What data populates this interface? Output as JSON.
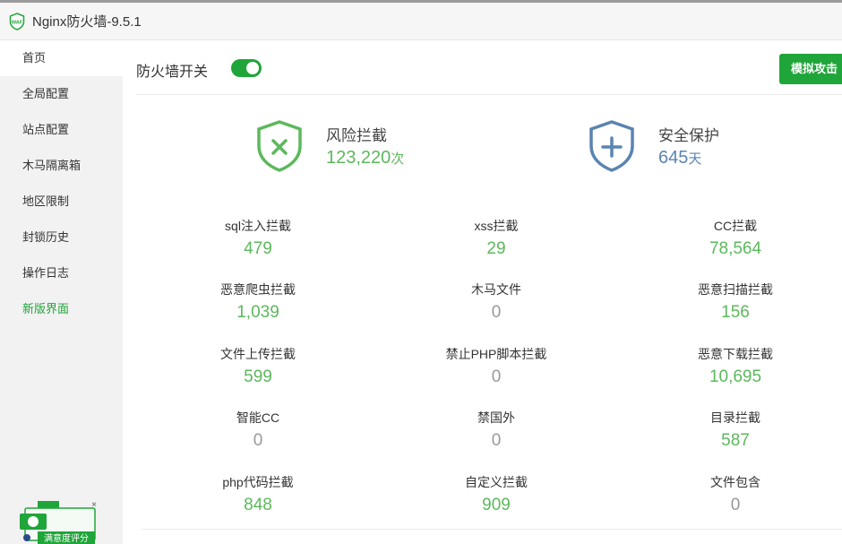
{
  "app": {
    "title": "Nginx防火墙-9.5.1",
    "icon": "waf-shield-icon"
  },
  "sidebar": {
    "items": [
      {
        "label": "首页",
        "active": true
      },
      {
        "label": "全局配置"
      },
      {
        "label": "站点配置"
      },
      {
        "label": "木马隔离箱"
      },
      {
        "label": "地区限制"
      },
      {
        "label": "封锁历史"
      },
      {
        "label": "操作日志"
      },
      {
        "label": "新版界面",
        "highlight": true
      }
    ],
    "promo": {
      "label": "满意度评分",
      "close": "×"
    }
  },
  "header": {
    "switch_label": "防火墙开关",
    "switch_on": true,
    "simulate_button": "模拟攻击"
  },
  "summary": {
    "risk": {
      "label": "风险拦截",
      "value": "123,220",
      "unit": "次"
    },
    "safe": {
      "label": "安全保护",
      "value": "645",
      "unit": "天"
    }
  },
  "stats": [
    [
      {
        "label": "sql注入拦截",
        "value": "479"
      },
      {
        "label": "xss拦截",
        "value": "29"
      },
      {
        "label": "CC拦截",
        "value": "78,564"
      }
    ],
    [
      {
        "label": "恶意爬虫拦截",
        "value": "1,039"
      },
      {
        "label": "木马文件",
        "value": "0"
      },
      {
        "label": "恶意扫描拦截",
        "value": "156"
      }
    ],
    [
      {
        "label": "文件上传拦截",
        "value": "599"
      },
      {
        "label": "禁止PHP脚本拦截",
        "value": "0"
      },
      {
        "label": "恶意下载拦截",
        "value": "10,695"
      }
    ],
    [
      {
        "label": "智能CC",
        "value": "0"
      },
      {
        "label": "禁国外",
        "value": "0"
      },
      {
        "label": "目录拦截",
        "value": "587"
      }
    ],
    [
      {
        "label": "php代码拦截",
        "value": "848"
      },
      {
        "label": "自定义拦截",
        "value": "909"
      },
      {
        "label": "文件包含",
        "value": "0"
      }
    ]
  ],
  "colors": {
    "accent": "#20a53a",
    "value_green": "#5cb85c",
    "value_zero": "#999999",
    "safe_blue": "#5b84b1"
  }
}
